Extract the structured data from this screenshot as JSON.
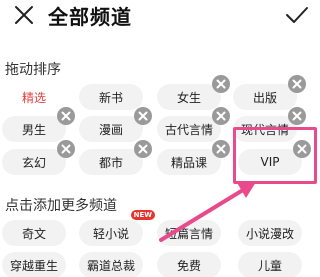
{
  "header": {
    "title": "全部频道"
  },
  "sections": {
    "drag_label": "拖动排序",
    "add_label": "点击添加更多频道"
  },
  "my_channels": [
    "精选",
    "新书",
    "女生",
    "出版",
    "男生",
    "漫画",
    "古代言情",
    "现代言情",
    "玄幻",
    "都市",
    "精品课",
    "VIP"
  ],
  "more_channels": [
    "奇文",
    "轻小说",
    "短篇言情",
    "小说漫改",
    "穿越重生",
    "霸道总裁",
    "免费",
    "儿童"
  ],
  "badges": {
    "new_label": "NEW"
  },
  "colors": {
    "accent_red": "#e0423d",
    "annotation_pink": "#e84a8c",
    "delete_badge": "#9a9a9a",
    "chip_bg": "#f2f2f2"
  },
  "icons": {
    "close": "close-icon",
    "confirm": "check-icon",
    "delete": "delete-icon"
  }
}
